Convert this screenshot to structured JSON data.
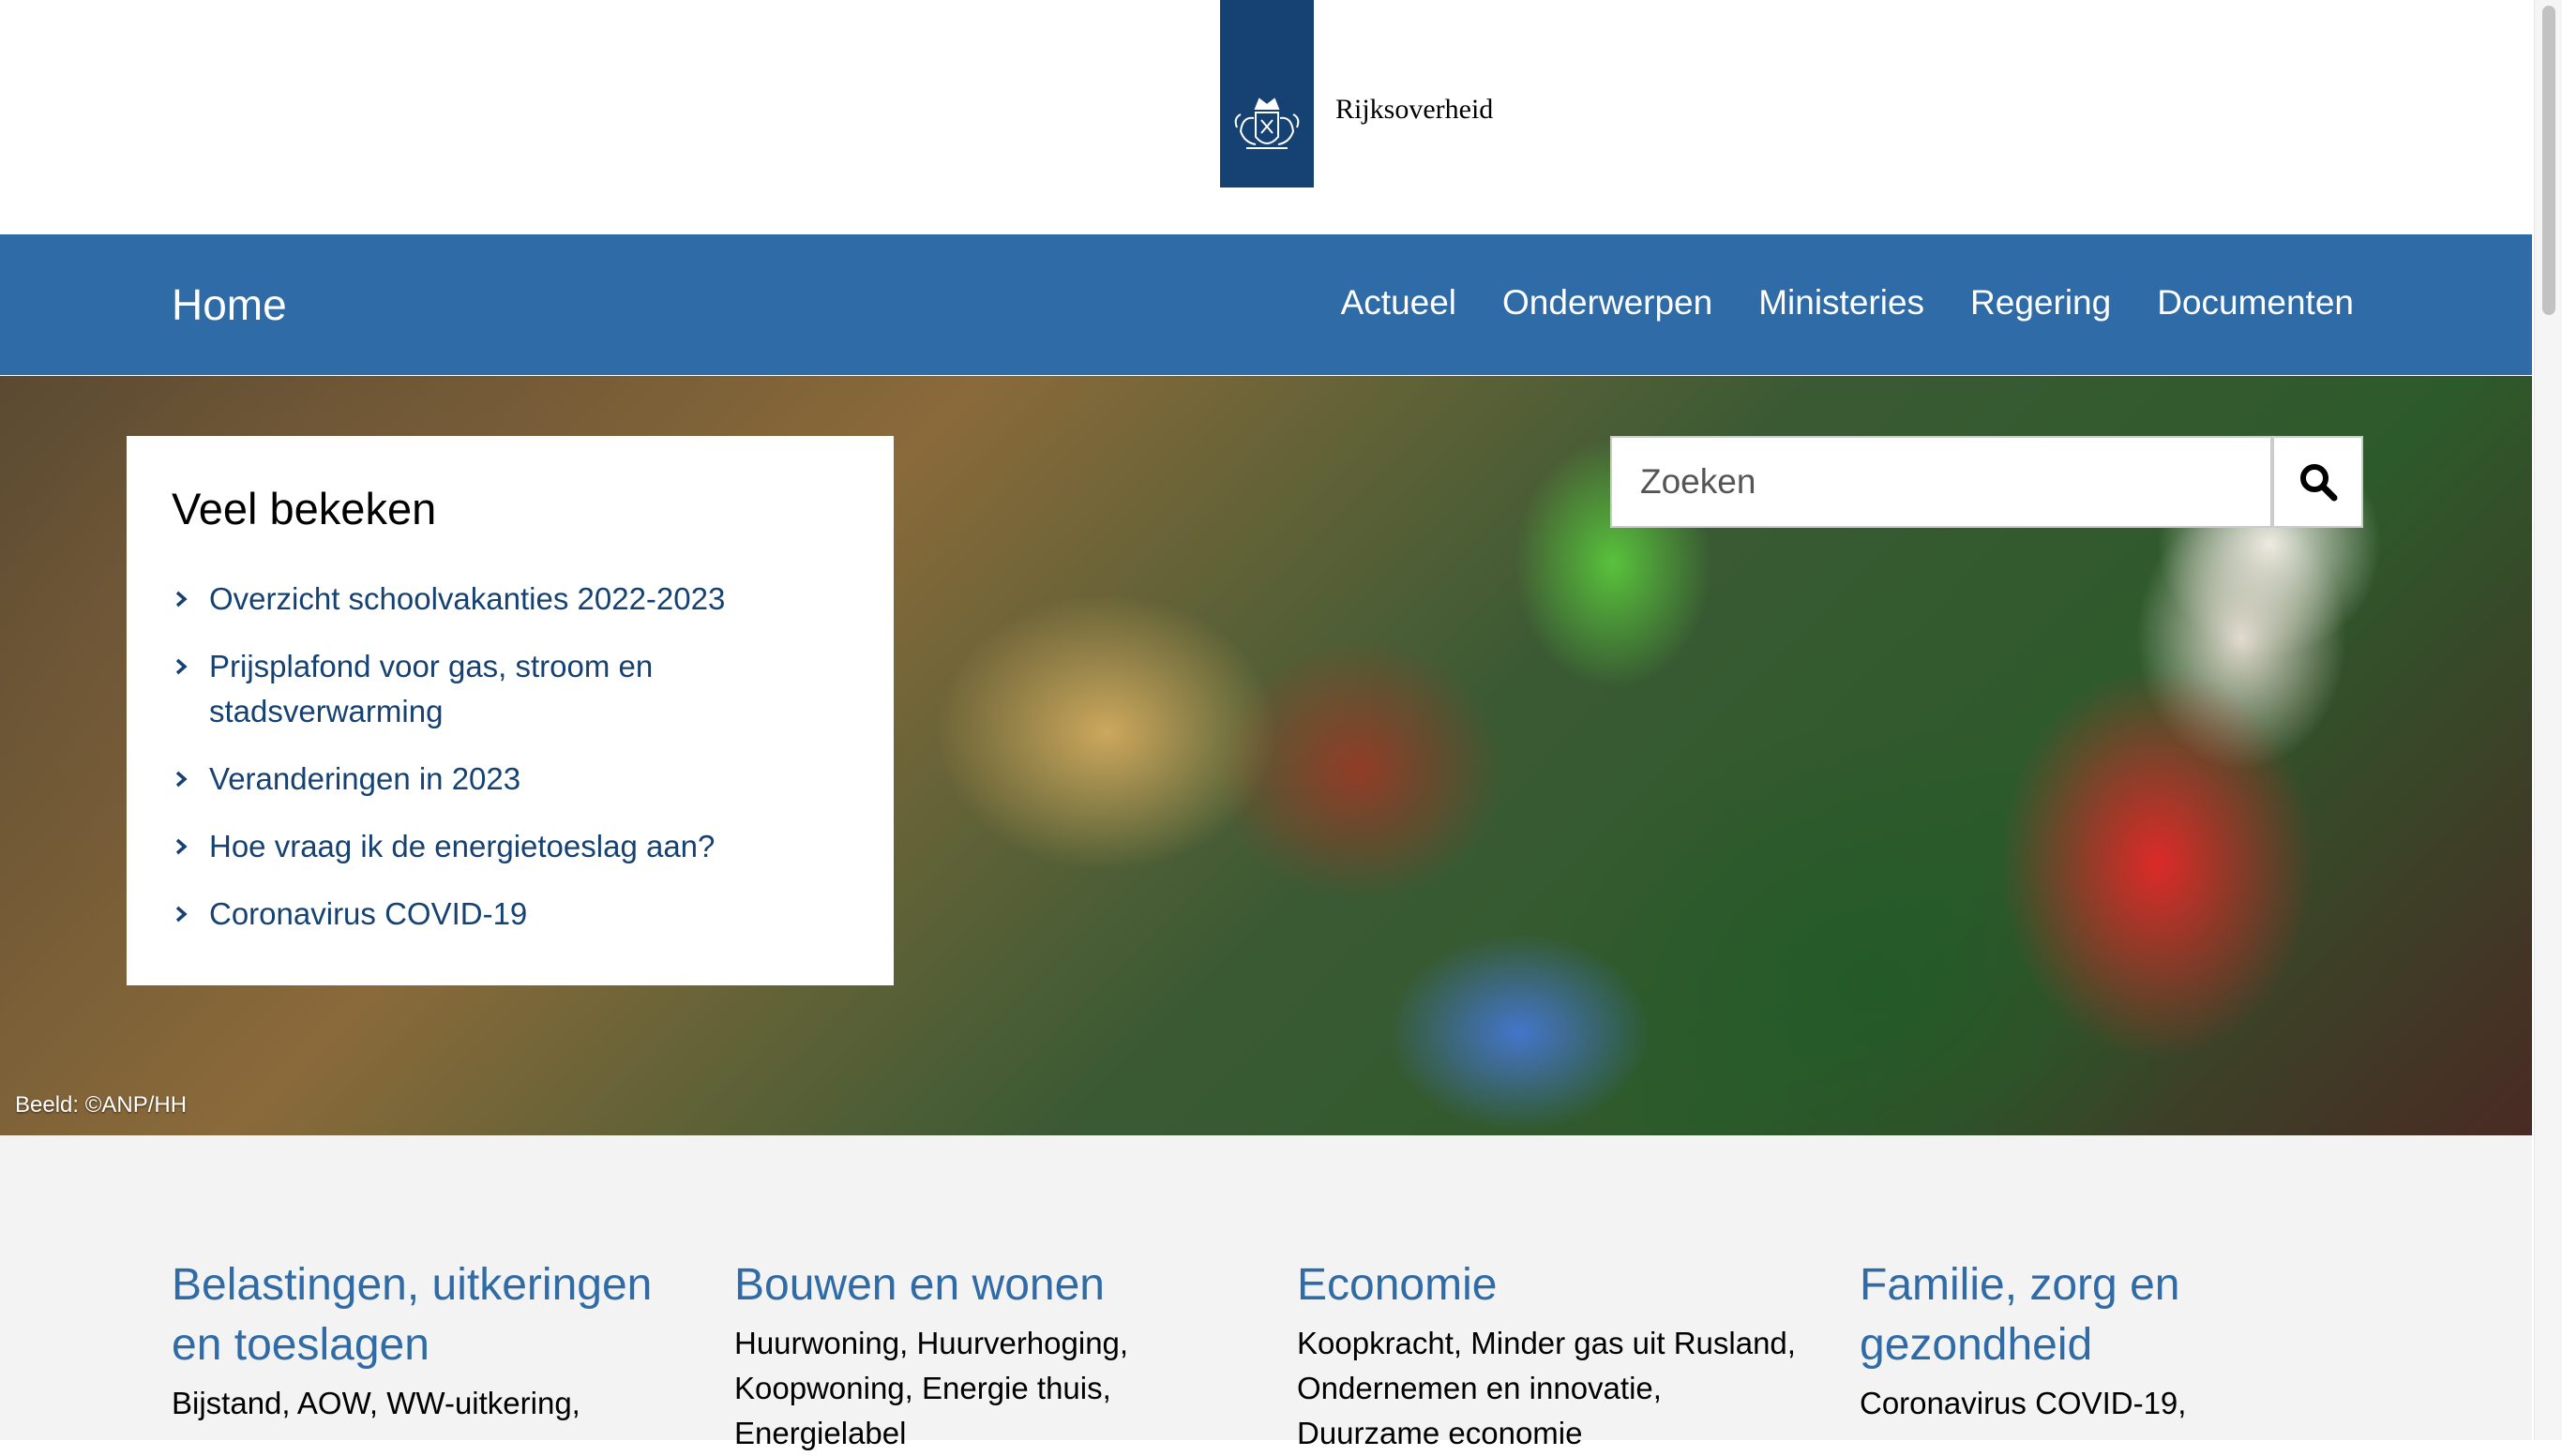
{
  "header": {
    "logo_text": "Rijksoverheid",
    "logo_color": "#154273"
  },
  "nav": {
    "home": "Home",
    "links": [
      "Actueel",
      "Onderwerpen",
      "Ministeries",
      "Regering",
      "Documenten"
    ],
    "bg_color": "#2f6ba6"
  },
  "hero": {
    "credit": "Beeld: ©ANP/HH",
    "panel_title": "Veel bekeken",
    "items": [
      "Overzicht schoolvakanties 2022-2023",
      "Prijsplafond voor gas, stroom en stadsverwarming",
      "Veranderingen in 2023",
      "Hoe vraag ik de energietoeslag aan?",
      "Coronavirus COVID-19"
    ],
    "link_color": "#154273"
  },
  "search": {
    "placeholder": "Zoeken",
    "icon": "search-icon"
  },
  "topics": [
    {
      "title": "Belastingen, uitkeringen en toeslagen",
      "desc": "Bijstand, AOW, WW-uitkering,"
    },
    {
      "title": "Bouwen en wonen",
      "desc": "Huurwoning, Huurverhoging, Koopwoning, Energie thuis, Energielabel"
    },
    {
      "title": "Economie",
      "desc": "Koopkracht, Minder gas uit Rusland, Ondernemen en innovatie, Duurzame economie"
    },
    {
      "title": "Familie, zorg en gezondheid",
      "desc": "Coronavirus COVID-19,"
    }
  ]
}
